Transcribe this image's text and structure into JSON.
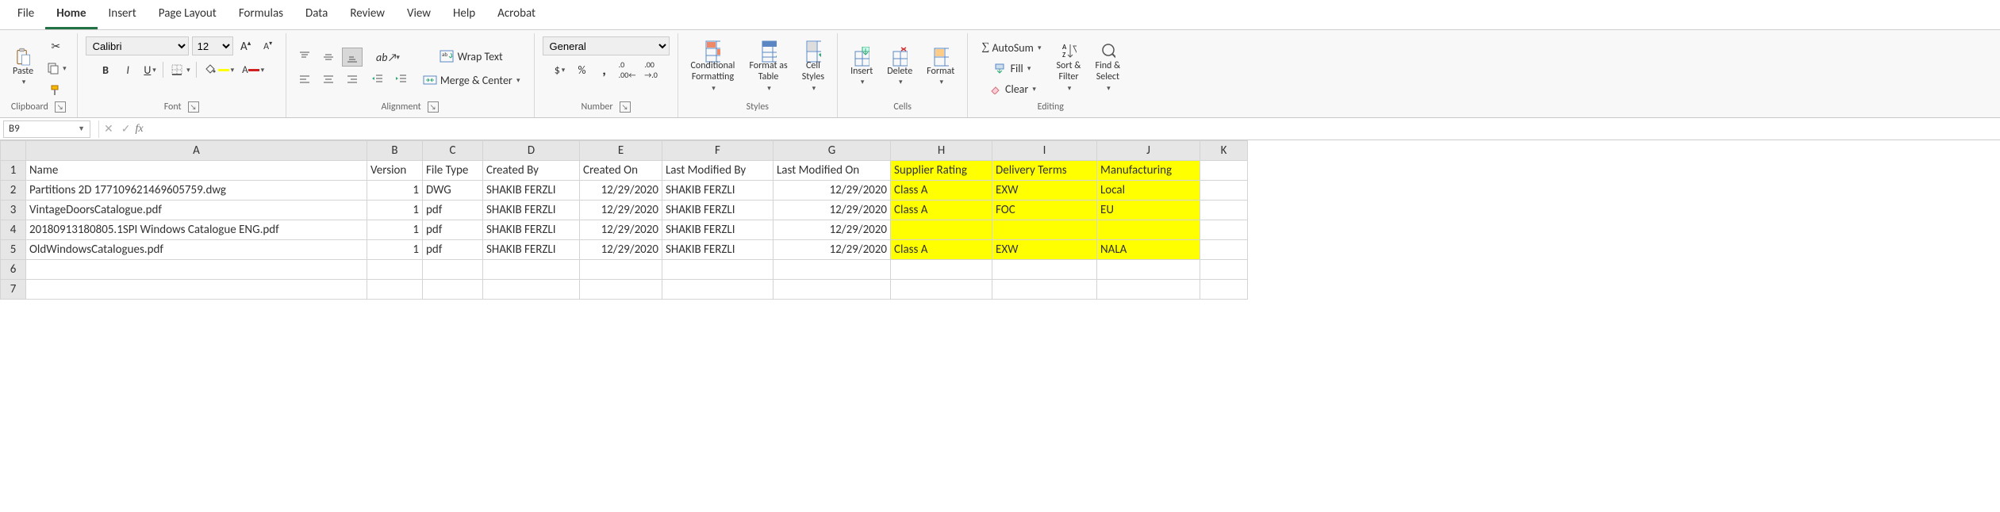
{
  "tabs": [
    "File",
    "Home",
    "Insert",
    "Page Layout",
    "Formulas",
    "Data",
    "Review",
    "View",
    "Help",
    "Acrobat"
  ],
  "active_tab": 1,
  "ribbon": {
    "clipboard": {
      "paste": "Paste",
      "label": "Clipboard"
    },
    "font": {
      "name": "Calibri",
      "size": "12",
      "bold": "B",
      "italic": "I",
      "underline": "U",
      "label": "Font"
    },
    "alignment": {
      "wrap": "Wrap Text",
      "merge": "Merge & Center",
      "label": "Alignment"
    },
    "number": {
      "format": "General",
      "label": "Number"
    },
    "styles": {
      "cond": "Conditional\nFormatting",
      "fmtTable": "Format as\nTable",
      "cellStyles": "Cell\nStyles",
      "label": "Styles"
    },
    "cells": {
      "insert": "Insert",
      "delete": "Delete",
      "format": "Format",
      "label": "Cells"
    },
    "editing": {
      "autosum": "AutoSum",
      "fill": "Fill",
      "clear": "Clear",
      "sort": "Sort &\nFilter",
      "find": "Find &\nSelect",
      "label": "Editing"
    }
  },
  "name_box": "B9",
  "formula": "",
  "columns": [
    "A",
    "B",
    "C",
    "D",
    "E",
    "F",
    "G",
    "H",
    "I",
    "J",
    "K"
  ],
  "headers": [
    "Name",
    "Version",
    "File Type",
    "Created By",
    "Created On",
    "Last Modified By",
    "Last Modified On",
    "Supplier Rating",
    "Delivery Terms",
    "Manufacturing"
  ],
  "rows": [
    {
      "name": "Partitions 2D 177109621469605759.dwg",
      "version": "1",
      "ftype": "DWG",
      "cby": "SHAKIB FERZLI",
      "con": "12/29/2020",
      "mby": "SHAKIB FERZLI",
      "mon": "12/29/2020",
      "rating": "Class A",
      "delivery": "EXW",
      "mfg": "Local"
    },
    {
      "name": "VintageDoorsCatalogue.pdf",
      "version": "1",
      "ftype": "pdf",
      "cby": "SHAKIB FERZLI",
      "con": "12/29/2020",
      "mby": "SHAKIB FERZLI",
      "mon": "12/29/2020",
      "rating": "Class A",
      "delivery": "FOC",
      "mfg": "EU"
    },
    {
      "name": "20180913180805.1SPI Windows Catalogue ENG.pdf",
      "version": "1",
      "ftype": "pdf",
      "cby": "SHAKIB FERZLI",
      "con": "12/29/2020",
      "mby": "SHAKIB FERZLI",
      "mon": "12/29/2020",
      "rating": "",
      "delivery": "",
      "mfg": ""
    },
    {
      "name": "OldWindowsCatalogues.pdf",
      "version": "1",
      "ftype": "pdf",
      "cby": "SHAKIB FERZLI",
      "con": "12/29/2020",
      "mby": "SHAKIB FERZLI",
      "mon": "12/29/2020",
      "rating": "Class A",
      "delivery": "EXW",
      "mfg": "NALA"
    }
  ],
  "visible_row_numbers": [
    "1",
    "2",
    "3",
    "4",
    "5",
    "6",
    "7"
  ]
}
